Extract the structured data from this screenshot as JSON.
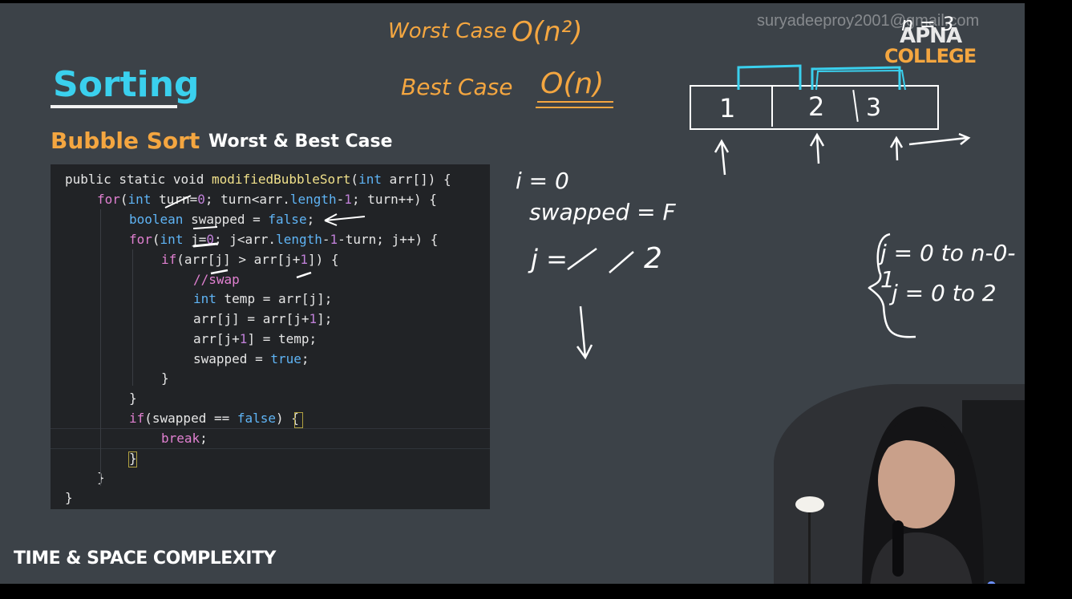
{
  "slide": {
    "title": "Sorting",
    "subtitle": "Bubble Sort",
    "heading": "Worst & Best Case",
    "watermark": "suryadeeproy2001@gmail.com",
    "logo_line1": "APNA",
    "logo_line2": "COLLEGE",
    "footer": "TIME & SPACE COMPLEXITY"
  },
  "annotations": {
    "worst_label": "Worst Case",
    "worst_value": "O(n²)",
    "best_label": "Best Case",
    "best_value": "O(n)",
    "array_values": [
      "1",
      "2",
      "3"
    ],
    "n_label": "n = 3",
    "i_label": "i = 0",
    "swapped_label": "swapped = F",
    "j_prefix": "j =",
    "j_final": "2",
    "range1": "j = 0 to n-0-1",
    "range2": "j = 0 to 2"
  },
  "code": {
    "line1": [
      "public static void ",
      "modifiedBubbleSort",
      "(",
      "int",
      " arr[]) {"
    ],
    "line2": [
      "for",
      "(",
      "int",
      " turn=",
      "0",
      "; turn<arr.",
      "length",
      "-",
      "1",
      "; turn++) {"
    ],
    "line3": [
      "boolean",
      " swapped = ",
      "false",
      ";"
    ],
    "line4": [
      "for",
      "(",
      "int",
      " j=",
      "0",
      "; j<arr.",
      "length",
      "-",
      "1",
      "-turn; j++) {"
    ],
    "line5": [
      "if",
      "(arr[j] > arr[j+",
      "1",
      "]) {"
    ],
    "line6": [
      "//swap"
    ],
    "line7": [
      "int",
      " temp = arr[j];"
    ],
    "line8": [
      "arr[j] = arr[j+",
      "1",
      "];"
    ],
    "line9": [
      "arr[j+",
      "1",
      "] = temp;"
    ],
    "line10": [
      "swapped = ",
      "true",
      ";"
    ],
    "line11": [
      "}"
    ],
    "line12": [
      "}"
    ],
    "line13": [
      "if",
      "(swapped == ",
      "false",
      ") {"
    ],
    "line14": [
      "break",
      ";"
    ],
    "line15": [
      "}"
    ],
    "line16": [
      "}"
    ],
    "line17": [
      "}"
    ]
  },
  "video": {
    "progress": 0.968
  },
  "colors": {
    "background": "#3c4248",
    "title": "#3ad0ee",
    "accent_orange": "#f4a640",
    "code_bg": "#212326",
    "progress": "#4d78e0"
  }
}
